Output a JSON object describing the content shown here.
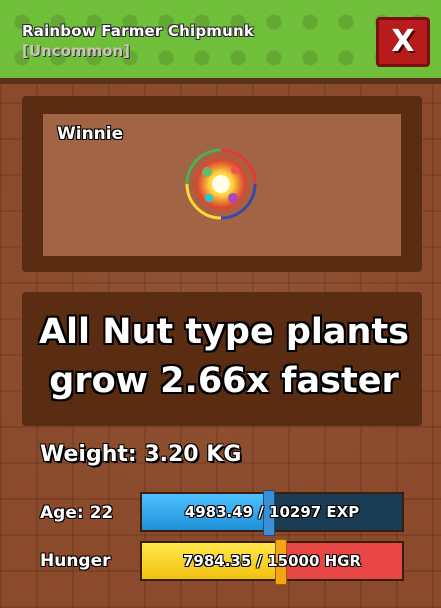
{
  "header": {
    "title": "Rainbow Farmer Chipmunk",
    "rarity": "[Uncommon]",
    "close_label": "X"
  },
  "pet": {
    "name": "Winnie",
    "sprite_icon": "rainbow-chipmunk-icon"
  },
  "ability": {
    "description": "All Nut type plants grow 2.66x faster"
  },
  "stats": {
    "weight_text": "Weight: 3.20 KG",
    "age_label": "Age: 22",
    "exp_text": "4983.49 / 10297 EXP",
    "exp_current": 4983.49,
    "exp_max": 10297,
    "hunger_label": "Hunger",
    "hunger_text": "7984.35 / 15000 HGR",
    "hunger_current": 7984.35,
    "hunger_max": 15000
  },
  "colors": {
    "header_green": "#6fbf3a",
    "panel_brown": "#8a4a2b",
    "close_red": "#b71c1c",
    "exp_blue": "#1f8fd6",
    "hunger_yellow": "#f2c010",
    "hunger_red": "#e84545"
  }
}
